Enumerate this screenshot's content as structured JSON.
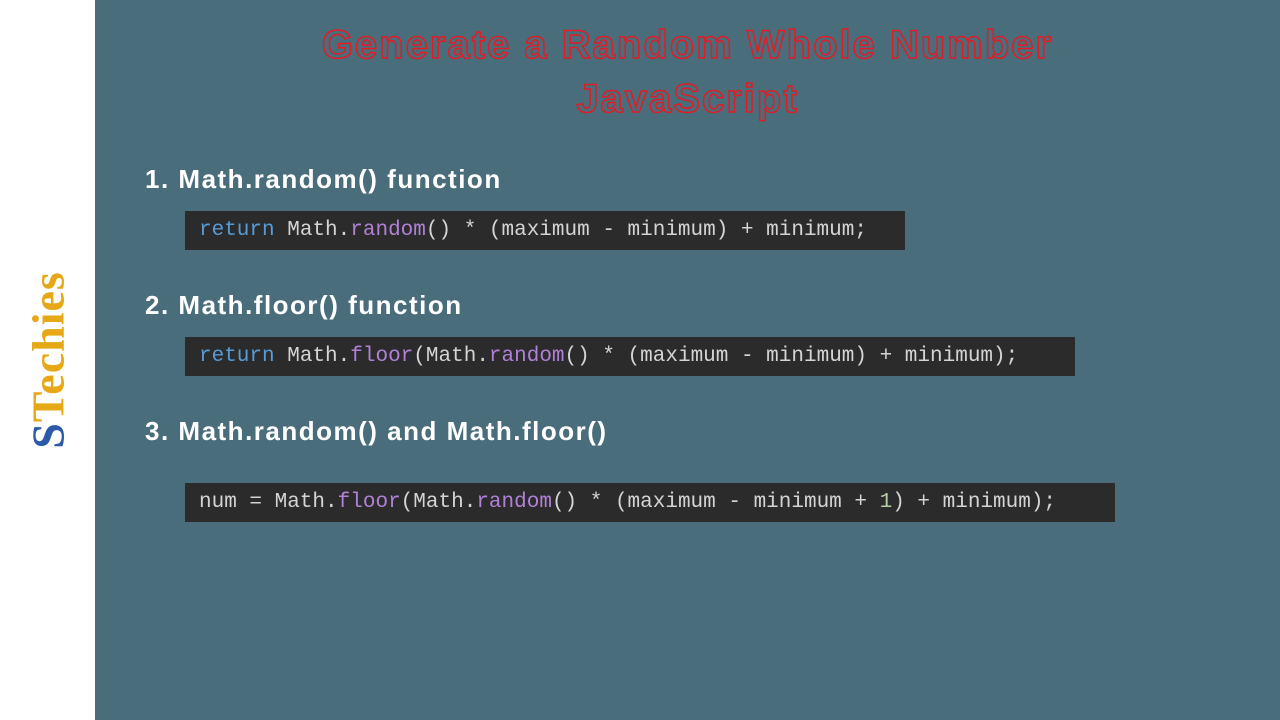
{
  "logo": {
    "text": "STechies"
  },
  "title": {
    "line1": "Generate a Random Whole Number",
    "line2": "JavaScript"
  },
  "sections": [
    {
      "heading": "1. Math.random() function",
      "code_tokens": [
        {
          "t": "return",
          "c": "kw"
        },
        {
          "t": " ",
          "c": "punc"
        },
        {
          "t": "Math",
          "c": "obj"
        },
        {
          "t": ".",
          "c": "punc"
        },
        {
          "t": "random",
          "c": "prop"
        },
        {
          "t": "() * (maximum - minimum) + minimum;",
          "c": "punc"
        }
      ]
    },
    {
      "heading": "2. Math.floor() function",
      "code_tokens": [
        {
          "t": "return",
          "c": "kw"
        },
        {
          "t": " ",
          "c": "punc"
        },
        {
          "t": "Math",
          "c": "obj"
        },
        {
          "t": ".",
          "c": "punc"
        },
        {
          "t": "floor",
          "c": "prop"
        },
        {
          "t": "(",
          "c": "punc"
        },
        {
          "t": "Math",
          "c": "obj"
        },
        {
          "t": ".",
          "c": "punc"
        },
        {
          "t": "random",
          "c": "prop"
        },
        {
          "t": "() * (maximum - minimum) + minimum);",
          "c": "punc"
        }
      ]
    },
    {
      "heading": "3. Math.random() and Math.floor()",
      "code_tokens": [
        {
          "t": "num = ",
          "c": "punc"
        },
        {
          "t": "Math",
          "c": "obj"
        },
        {
          "t": ".",
          "c": "punc"
        },
        {
          "t": "floor",
          "c": "prop"
        },
        {
          "t": "(",
          "c": "punc"
        },
        {
          "t": "Math",
          "c": "obj"
        },
        {
          "t": ".",
          "c": "punc"
        },
        {
          "t": "random",
          "c": "prop"
        },
        {
          "t": "() * (maximum - minimum + ",
          "c": "punc"
        },
        {
          "t": "1",
          "c": "num"
        },
        {
          "t": ") + minimum);",
          "c": "punc"
        }
      ]
    }
  ]
}
